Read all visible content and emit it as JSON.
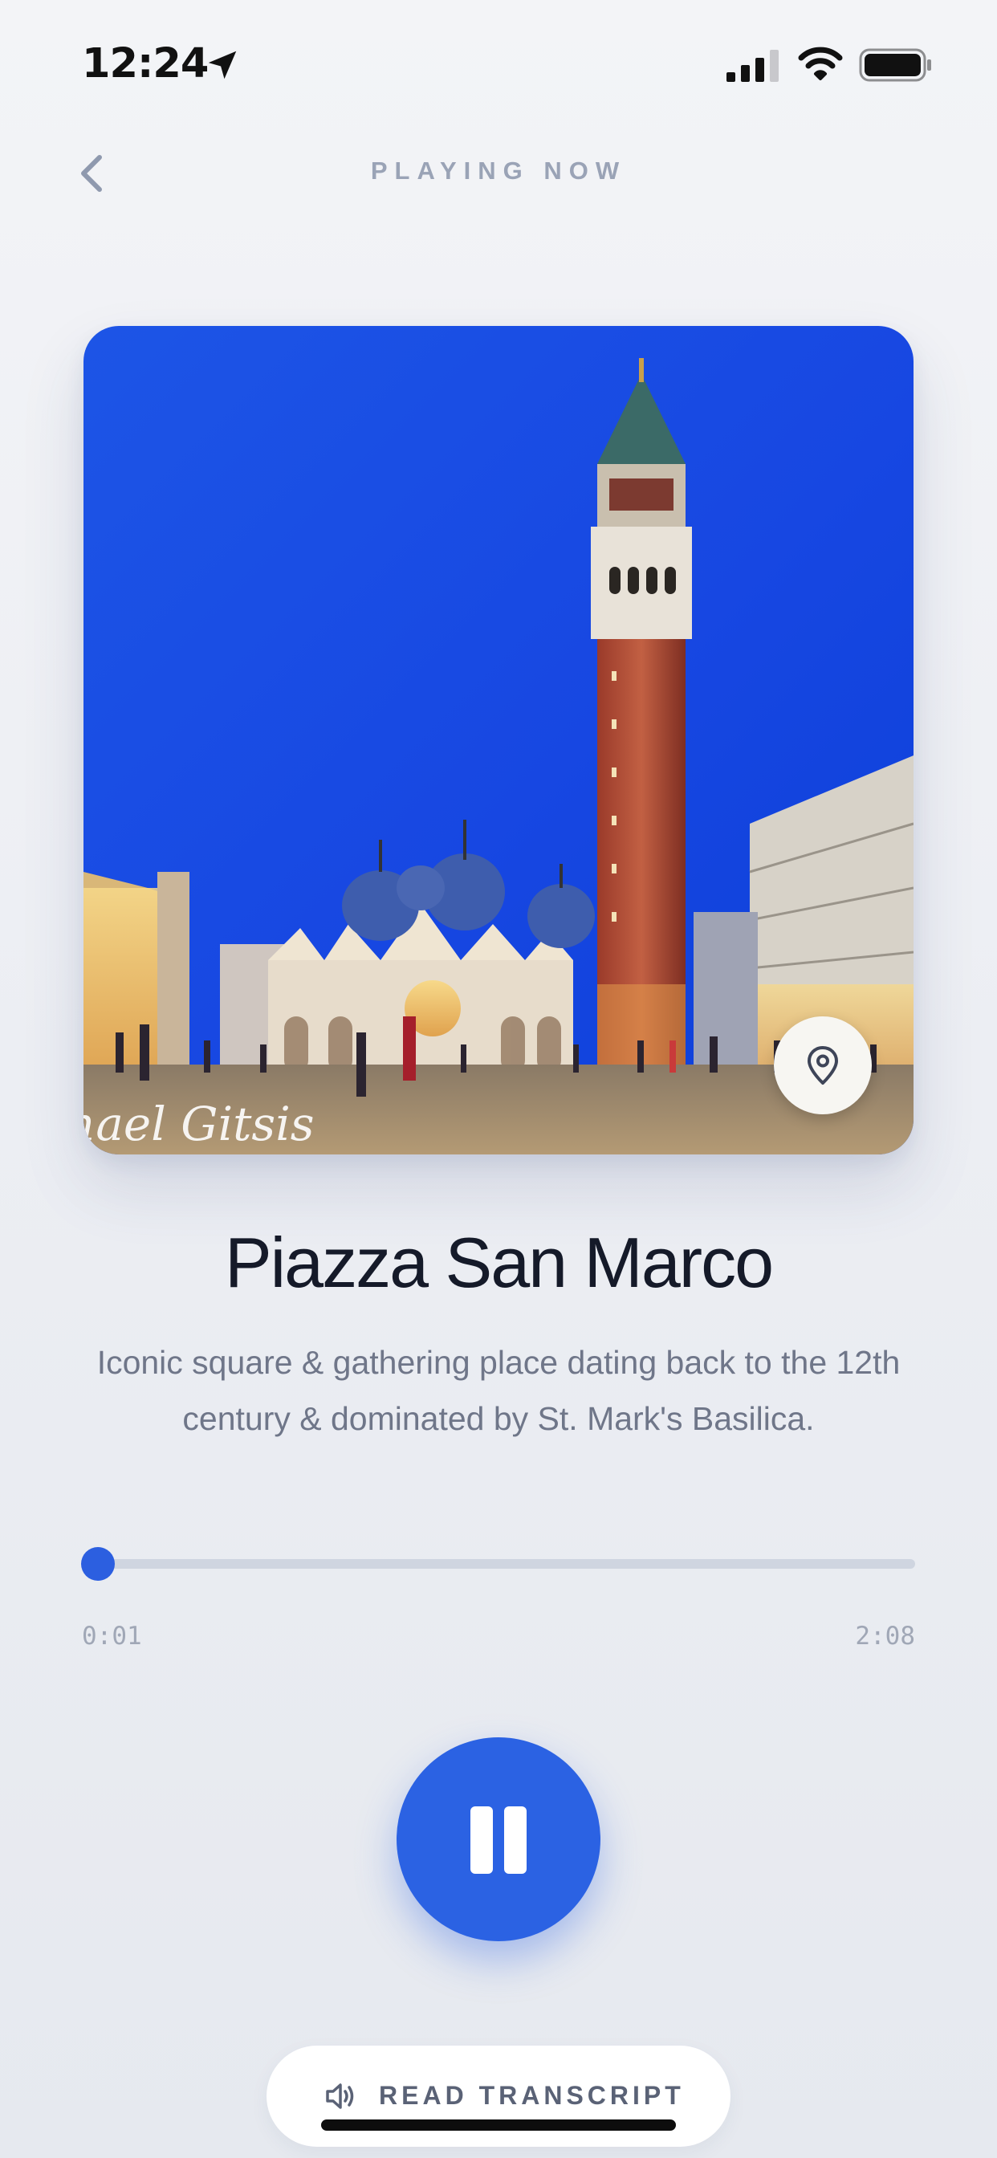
{
  "status_bar": {
    "time": "12:24",
    "icons": [
      "location-arrow-icon",
      "cellular-signal-icon",
      "wifi-icon",
      "battery-icon"
    ]
  },
  "header": {
    "title": "PLAYING NOW",
    "back_icon": "chevron-left-icon"
  },
  "artwork": {
    "watermark": "hael Gitsis",
    "map_button_icon": "map-pin-icon"
  },
  "track": {
    "title": "Piazza San Marco",
    "description": "Iconic square & gathering place dating back to the 12th century & dominated by St. Mark's Basilica."
  },
  "player": {
    "elapsed": "0:01",
    "total": "2:08",
    "progress_fraction": 0.008,
    "state_icon": "pause-icon"
  },
  "transcript": {
    "label": "READ TRANSCRIPT",
    "icon": "speaker-icon"
  },
  "colors": {
    "accent": "#2b62e3",
    "muted_text": "#9aa3b6",
    "title_text": "#151a29",
    "track": "#cfd5e0"
  }
}
